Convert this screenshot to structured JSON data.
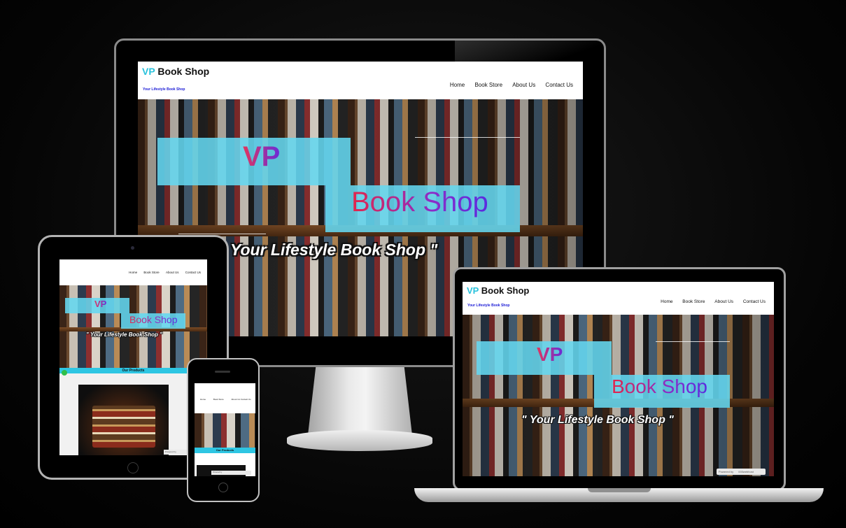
{
  "site": {
    "brand_vp": "VP",
    "brand_rest": "Book Shop",
    "tagline": "Your Lifestyle Book Shop",
    "nav": [
      "Home",
      "Book Store",
      "About Us",
      "Contact Us"
    ],
    "hero_vp": "VP",
    "hero_title": "Book Shop",
    "slogan_desktop": "Your Lifestyle Book Shop \"",
    "slogan_laptop": "\" Your Lifestyle Book Shop \"",
    "slogan_tablet": "\" Your Lifestyle Book Shop \"",
    "products_heading": "Our Products",
    "powered_by": "Powered by",
    "host": "000webhost"
  },
  "colors": {
    "accent_cyan": "#29c2dc",
    "tagline_blue": "#1b1bd6",
    "gradient_start": "#e3264a",
    "gradient_end": "#5a2be0"
  },
  "devices": [
    "desktop-monitor",
    "laptop",
    "tablet",
    "phone"
  ]
}
